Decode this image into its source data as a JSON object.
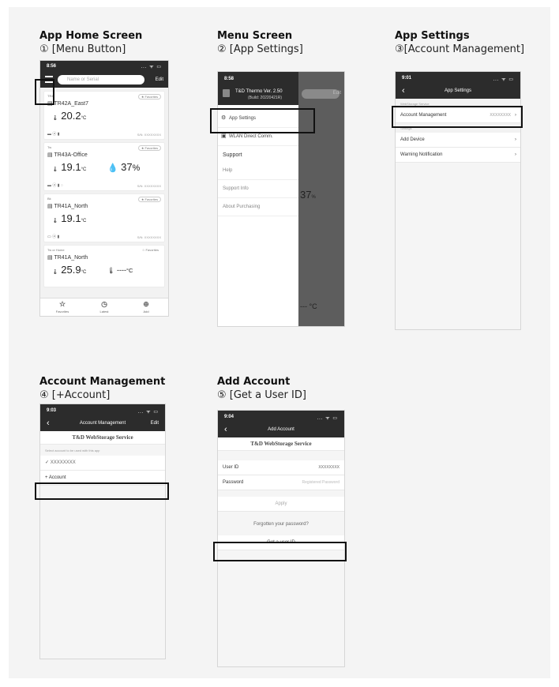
{
  "panels": [
    {
      "title": "App Home Screen",
      "step": "① [Menu Button]"
    },
    {
      "title": "Menu Screen",
      "step": "② [App Settings]"
    },
    {
      "title": "App Settings",
      "step": "③[Account Management]"
    },
    {
      "title": "Account Management",
      "step": "④ [+Account]"
    },
    {
      "title": "Add Account",
      "step": "⑤ [Get a User ID]"
    }
  ],
  "home": {
    "time": "8:56",
    "status_icons": "... ᯤ ▭",
    "search_placeholder": "Name or Serial",
    "edit": "Edit",
    "cards": [
      {
        "group": "TR4",
        "name": "TR42A_East7",
        "reading": "20.2",
        "unit": "°C",
        "reading2": "",
        "unit2": "",
        "favorite": "★ Favorites",
        "icons": "▬ ⓐ ▮",
        "serial": "S/N: XXXXXXXX"
      },
      {
        "group": "Tw",
        "name": "TR43A-Office",
        "reading": "19.1",
        "unit": "°C",
        "reading2": "37",
        "unit2": "%",
        "favorite": "★ Favorites",
        "icons": "▬ ⓐ ▮ ◌",
        "serial": "S/N: XXXXXXXX"
      },
      {
        "group": "Bk",
        "name": "TR41A_North",
        "reading": "19.1",
        "unit": "°C",
        "reading2": "",
        "unit2": "",
        "favorite": "★ Favorites",
        "icons": "▭ ⓐ ▮",
        "serial": "S/N: XXXXXXXX"
      },
      {
        "group": "Tw or Home",
        "name": "TR41A_North",
        "reading": "25.9",
        "unit": "°C",
        "reading2": "----",
        "unit2": "°C",
        "favorite": "☆ Favorites",
        "icons": "",
        "serial": ""
      }
    ],
    "tabs": [
      {
        "icon": "☆",
        "label": "Favorites"
      },
      {
        "icon": "◷",
        "label": "Latest"
      },
      {
        "icon": "⊕",
        "label": "Add"
      }
    ]
  },
  "menu": {
    "time": "8:58",
    "app_name": "T&D Thermo Ver. 2.50",
    "build": "(Build: 20220421R)",
    "edit": "Edit",
    "items": [
      "App Settings",
      "WLAN Direct Comm."
    ],
    "support_header": "Support",
    "support_items": [
      "Help",
      "Support Info",
      "About Purchasing"
    ],
    "bg_value": "37",
    "bg_unit": "%",
    "bg_unit2": "°C"
  },
  "settings": {
    "time": "9:01",
    "title": "App Settings",
    "section1": "WebStorage Service",
    "account_label": "Account Management",
    "account_value": "XXXXXXXX",
    "section2": "Settings",
    "items": [
      "Add Device",
      "Warning Notification"
    ]
  },
  "account": {
    "time": "9:03",
    "title": "Account Management",
    "edit": "Edit",
    "service": "T&D WebStorage Service",
    "note": "Select account to be used with this app",
    "current": "XXXXXXXX",
    "add": "+ Account"
  },
  "add": {
    "time": "9:04",
    "title": "Add Account",
    "service": "T&D WebStorage Service",
    "user_label": "User ID",
    "user_value": "XXXXXXXX",
    "pw_label": "Password",
    "pw_placeholder": "Registered Password",
    "apply": "Apply",
    "forgot": "Forgotten your password?",
    "get_id": "Get a user ID"
  }
}
